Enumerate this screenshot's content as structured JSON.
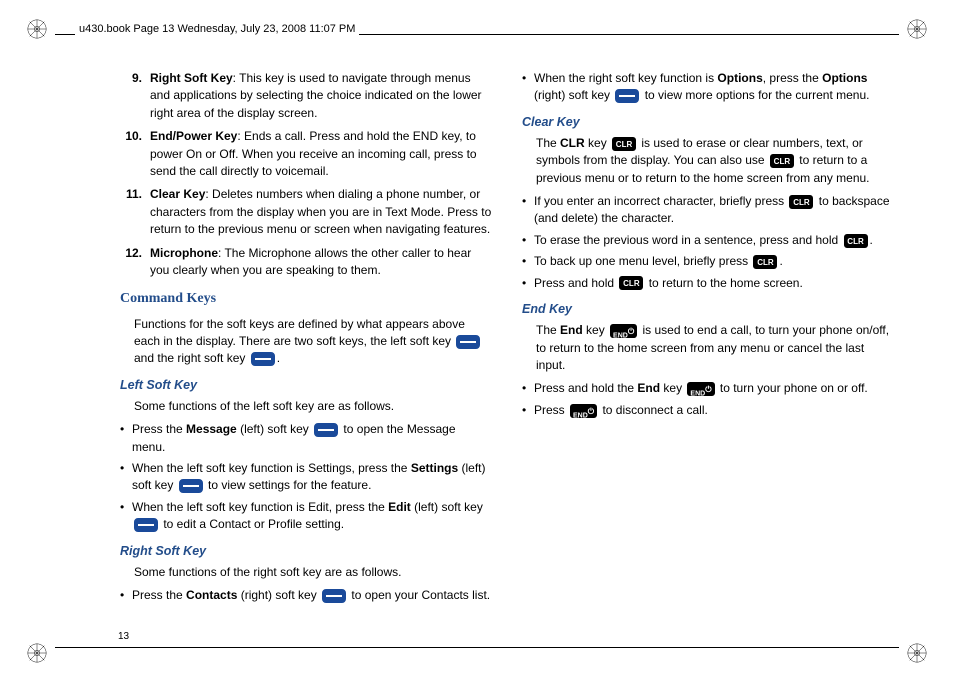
{
  "header": {
    "meta": "u430.book  Page 13  Wednesday, July 23, 2008  11:07 PM"
  },
  "page_number": "13",
  "ol": {
    "9": {
      "num": "9.",
      "term": "Right Soft Key",
      "desc": ": This key is used to navigate through menus and applications by selecting the choice indicated on the lower right area of the display screen."
    },
    "10": {
      "num": "10.",
      "term": "End/Power Key",
      "desc": ": Ends a call. Press and hold the END key, to power On or Off. When you receive an incoming call, press to send the call directly to voicemail."
    },
    "11": {
      "num": "11.",
      "term": "Clear Key",
      "desc": ": Deletes numbers when dialing a phone number, or characters from the display when you are in Text Mode. Press to return to the previous menu or screen when navigating features."
    },
    "12": {
      "num": "12.",
      "term": "Microphone",
      "desc": ": The Microphone allows the other caller to hear you clearly when you are speaking to them."
    }
  },
  "sections": {
    "cmd": {
      "heading": "Command Keys",
      "para_a": "Functions for the soft keys are defined by what appears above each in the display. There are two soft keys, the left soft key ",
      "para_b": " and the right soft key ",
      "para_c": "."
    },
    "left": {
      "heading": "Left Soft Key",
      "intro": "Some functions of the left soft key are as follows.",
      "b1a": "Press the ",
      "b1s": "Message",
      "b1b": " (left) soft key ",
      "b1c": " to open the Message menu.",
      "b2a": "When the left soft key function is Settings, press the ",
      "b2s": "Settings",
      "b2b": " (left) soft key ",
      "b2c": " to view settings for the feature.",
      "b3a": "When the left soft key function is Edit, press the ",
      "b3s": "Edit",
      "b3b": " (left) soft key ",
      "b3c": " to edit a Contact or Profile setting."
    },
    "right": {
      "heading": "Right Soft Key",
      "intro": "Some functions of the right soft key are as follows.",
      "b1a": "Press the ",
      "b1s": "Contacts",
      "b1b": " (right) soft key ",
      "b1c": " to open your Contacts list.",
      "b2a": "When the right soft key function is ",
      "b2s1": "Options",
      "b2b": ", press the ",
      "b2s2": "Options",
      "b2c": " (right) soft key ",
      "b2d": " to view more options for the current menu."
    },
    "clear": {
      "heading": "Clear Key",
      "p1a": "The ",
      "p1s": "CLR",
      "p1b": " key ",
      "p1c": " is used to erase or clear numbers, text, or symbols from the display. You can also use ",
      "p1d": " to return to a previous menu or to return to the home screen from any menu.",
      "b1a": "If you enter an incorrect character, briefly press ",
      "b1b": " to backspace (and delete) the character.",
      "b2a": "To erase the previous word in a sentence, press and hold ",
      "b2b": ".",
      "b3a": "To back up one menu level, briefly press ",
      "b3b": ".",
      "b4a": "Press and hold ",
      "b4b": " to return to the home screen."
    },
    "end": {
      "heading": "End Key",
      "p1a": "The ",
      "p1s": "End",
      "p1b": " key ",
      "p1c": " is used to end a call, to turn your phone on/off, to return to the home screen from any menu or cancel the last input.",
      "b1a": "Press and hold the ",
      "b1s": "End",
      "b1b": " key ",
      "b1c": " to turn your phone on or off.",
      "b2a": "Press ",
      "b2b": " to disconnect a call."
    }
  },
  "labels": {
    "clr": "CLR",
    "end": "END"
  }
}
